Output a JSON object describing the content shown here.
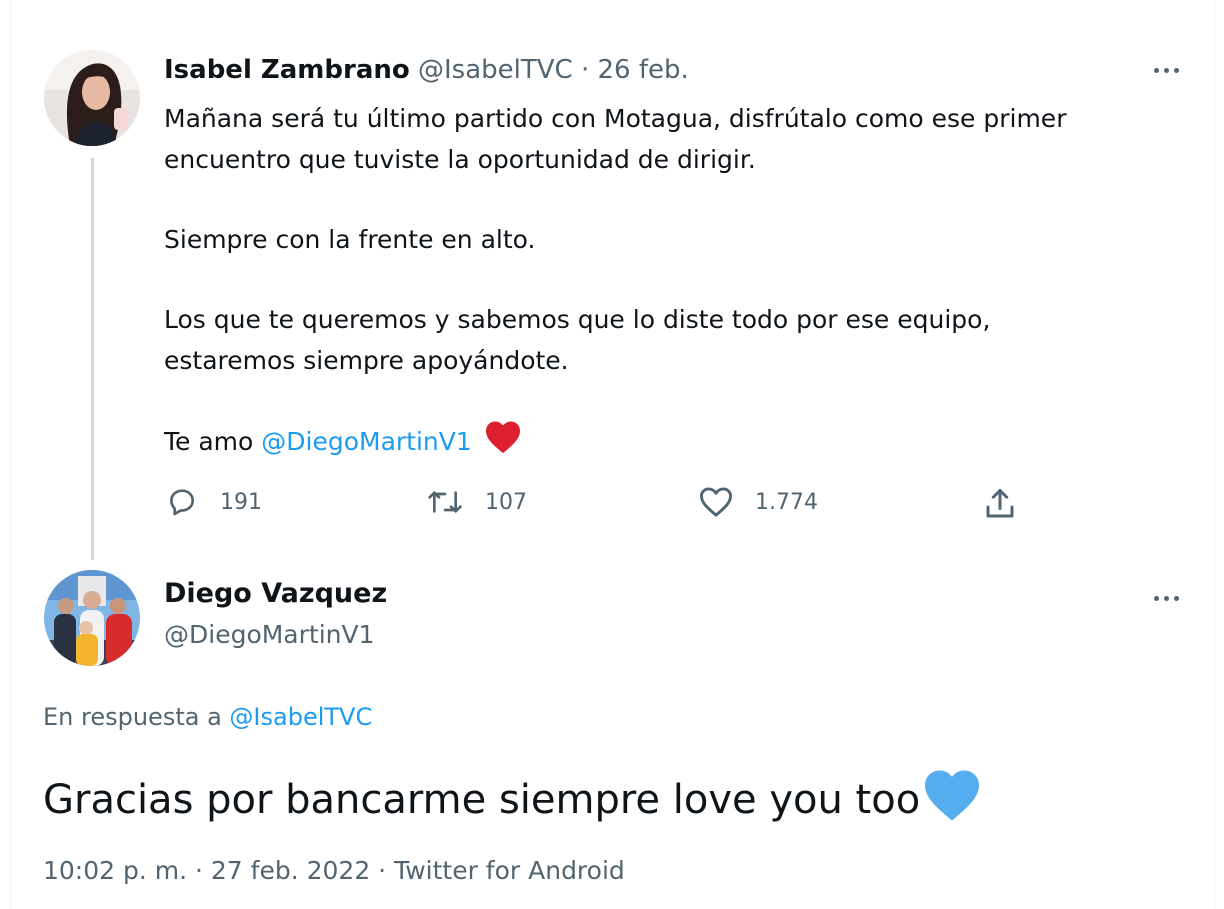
{
  "tweet1": {
    "author_name": "Isabel Zambrano",
    "author_handle": "@IsabelTVC",
    "date": "· 26 feb.",
    "body": {
      "line1": "Mañana será tu último partido con Motagua, disfrútalo como ese primer",
      "line2": "encuentro que tuviste la oportunidad de dirigir.",
      "line3": "Siempre con la frente en alto.",
      "line4": "Los que te queremos y sabemos que lo diste todo por ese equipo,",
      "line5": "estaremos siempre apoyándote.",
      "line6_prefix": "Te amo ",
      "line6_mention": "@DiegoMartinV1"
    },
    "stats": {
      "replies": "191",
      "retweets": "107",
      "likes": "1.774"
    }
  },
  "tweet2": {
    "author_name": "Diego Vazquez",
    "author_handle": "@DiegoMartinV1",
    "reply_prefix": "En respuesta a ",
    "reply_mention": "@IsabelTVC",
    "text": "Gracias por bancarme siempre love you too",
    "meta": "10:02 p. m. · 27 feb. 2022 · Twitter for Android"
  },
  "colors": {
    "accent": "#1d9bf0",
    "muted": "#536471",
    "heart_red": "#e0245e",
    "heart_blue": "#55acee"
  },
  "icons": [
    "reply-icon",
    "retweet-icon",
    "like-icon",
    "share-icon",
    "more-icon",
    "red-heart-emoji",
    "blue-heart-emoji"
  ]
}
